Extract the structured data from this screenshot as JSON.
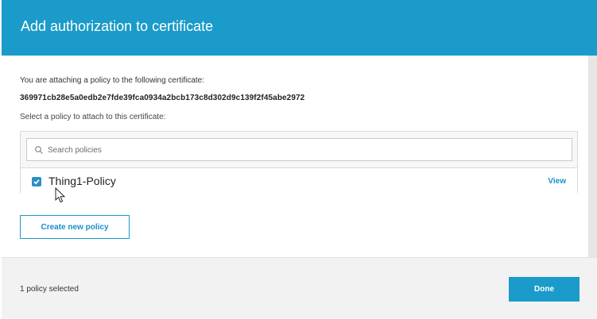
{
  "modal": {
    "title": "Add authorization to certificate",
    "intro": "You are attaching a policy to the following certificate:",
    "certificate_id": "369971cb28e5a0edb2e7fde39fca0934a2bcb173c8d302d9c139f2f45abe2972",
    "select_label": "Select a policy to attach to this certificate:"
  },
  "search": {
    "placeholder": "Search policies",
    "value": "",
    "icon": "search-icon"
  },
  "policies": [
    {
      "name": "Thing1-Policy",
      "checked": true,
      "view_label": "View"
    }
  ],
  "actions": {
    "create_label": "Create new policy",
    "done_label": "Done"
  },
  "footer": {
    "selected_text": "1 policy selected"
  },
  "colors": {
    "accent": "#1a9bc9",
    "link": "#1a8fc9",
    "checkbox": "#2e8fc7"
  }
}
